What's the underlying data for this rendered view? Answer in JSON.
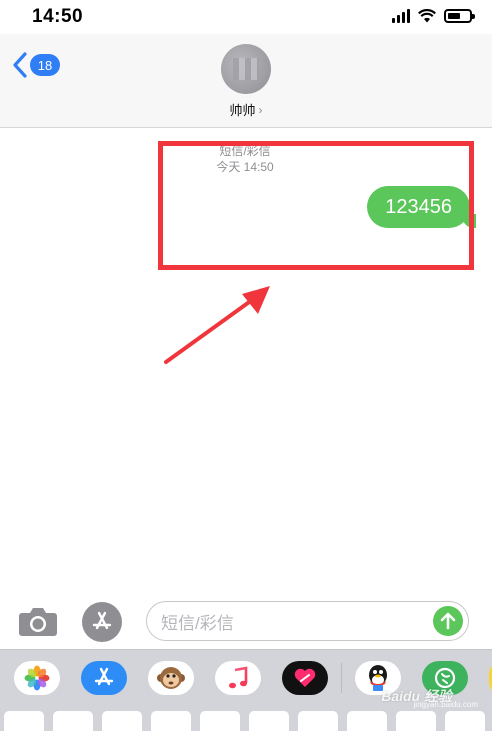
{
  "status": {
    "time": "14:50"
  },
  "nav": {
    "back_badge": "18",
    "contact_name": "帅帅"
  },
  "conversation": {
    "service_label": "短信/彩信",
    "timestamp": "今天 14:50",
    "messages": [
      {
        "direction": "outgoing",
        "text": "123456"
      }
    ]
  },
  "input": {
    "placeholder": "短信/彩信"
  },
  "app_strip": {
    "apps": [
      "photos-icon",
      "app-store-icon",
      "animoji-icon",
      "music-icon",
      "digital-touch-icon",
      "qq-icon",
      "green-app-icon"
    ]
  },
  "watermark": {
    "text": "Baidu 经验",
    "sub": "jingyan.baidu.com"
  },
  "colors": {
    "accent_blue": "#2f7ef6",
    "bubble_green": "#5bc65a",
    "annotation_red": "#f0353c"
  }
}
